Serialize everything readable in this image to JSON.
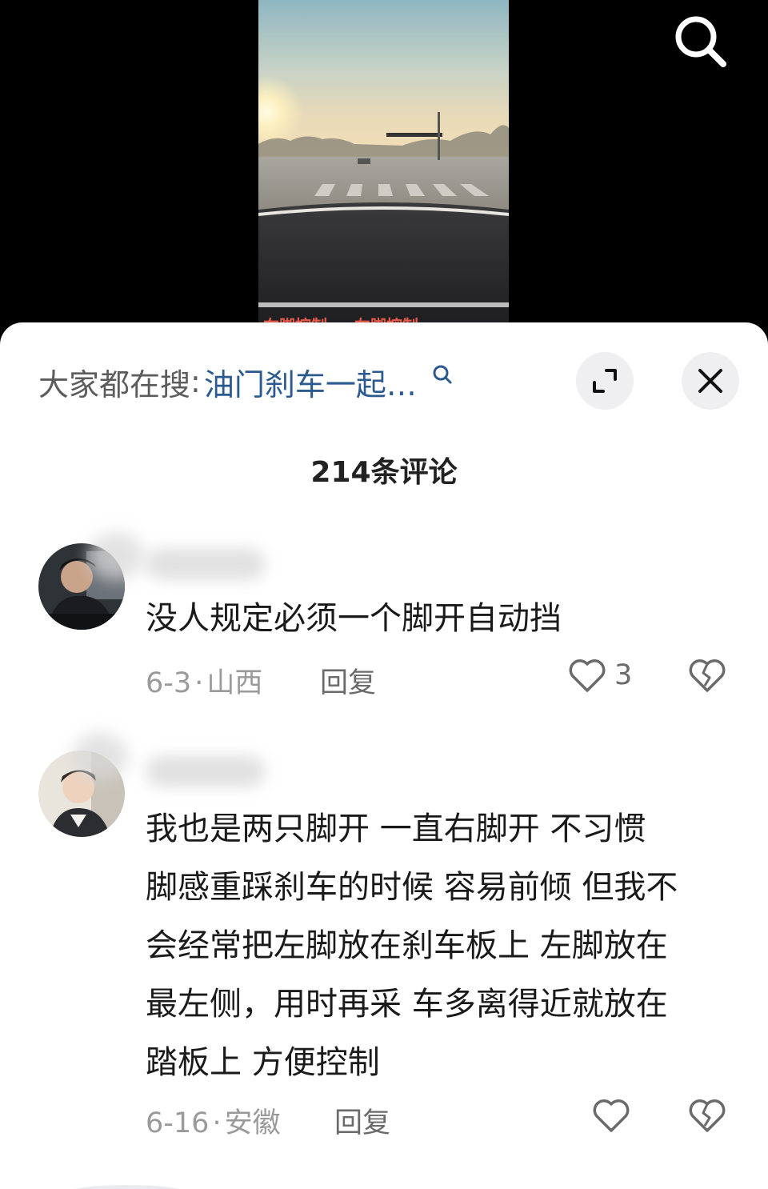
{
  "video": {
    "overlay_caption": "右脚控制 … 左脚控制 …"
  },
  "search_hint": {
    "label": "大家都在搜",
    "separator": ":",
    "query": "油门刹车一起…",
    "query_color": "#2b5a8f"
  },
  "header": {
    "comment_count": "214条评论"
  },
  "comments": [
    {
      "text": "没人规定必须一个脚开自动挡",
      "date": "6-3",
      "location": "山西",
      "reply_label": "回复",
      "likes": "3"
    },
    {
      "text_lines": [
        "我也是两只脚开 一直右脚开 不习惯",
        "脚感重踩刹车的时候 容易前倾 但我不",
        "会经常把左脚放在刹车板上 左脚放在",
        "最左侧，用时再采 车多离得近就放在",
        "踏板上 方便控制"
      ],
      "date": "6-16",
      "location": "安徽",
      "reply_label": "回复",
      "likes": ""
    }
  ],
  "icons": {
    "search": "search-icon",
    "expand": "expand-icon",
    "close": "close-icon",
    "like": "heart-icon",
    "dislike": "broken-heart-icon"
  }
}
